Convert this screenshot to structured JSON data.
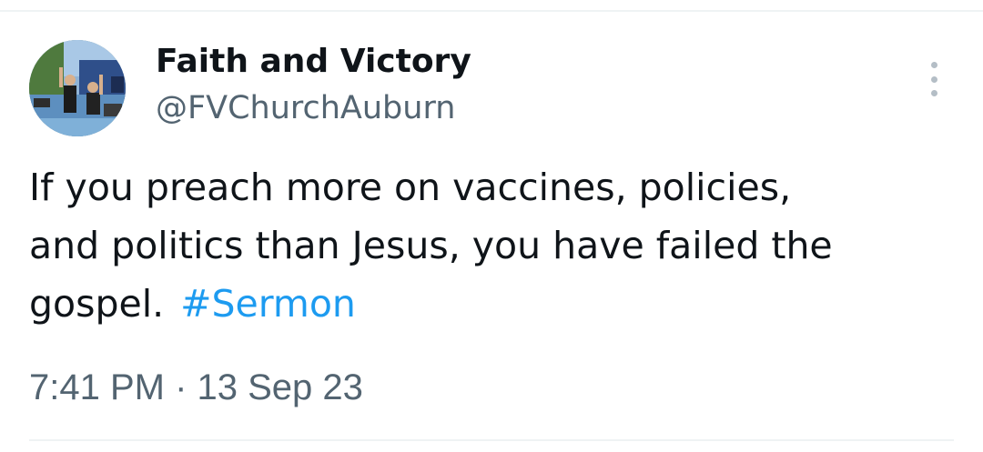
{
  "author": {
    "display_name": "Faith and Victory",
    "handle": "@FVChurchAuburn",
    "avatar_icon": "profile-photo"
  },
  "tweet": {
    "text_lines": [
      "If you preach more on vaccines, policies,",
      "and politics than Jesus, you have failed the",
      "gospel."
    ],
    "hashtag": "#Sermon",
    "timestamp": "7:41 PM · 13 Sep 23"
  },
  "menu": {
    "icon": "more-vertical-icon"
  },
  "colors": {
    "text": "#0f1419",
    "secondary_text": "#536471",
    "link": "#1d9bf0",
    "divider": "#eff3f4",
    "menu_dots": "#b4bec6"
  }
}
